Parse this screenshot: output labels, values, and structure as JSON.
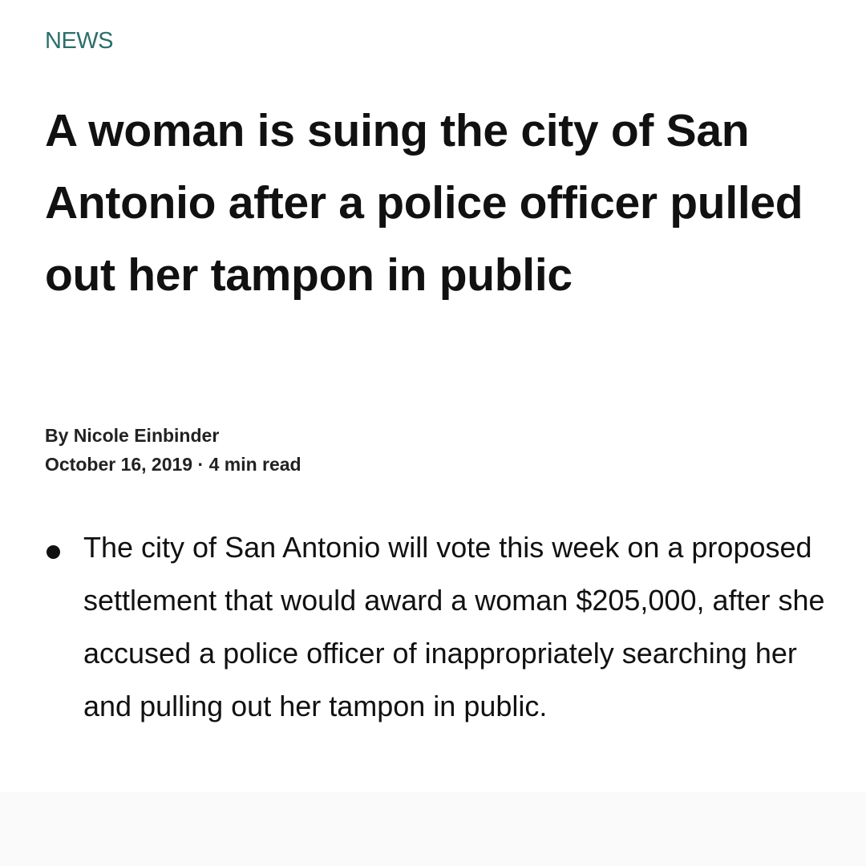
{
  "article": {
    "category": "NEWS",
    "headline": "A woman is suing the city of San Antonio after a police officer pulled out her tampon in public",
    "byline": {
      "prefix": "By ",
      "author": "Nicole Einbinder"
    },
    "date": "October 16, 2019",
    "separator": "·",
    "read_time": "4 min read",
    "bullets": [
      "The city of San Antonio will vote this week on a proposed settlement that would award a woman $205,000, after she accused a police officer of inappropriately searching her and pulling out her tampon in public."
    ]
  },
  "colors": {
    "category": "#2b6f6b",
    "text": "#111111",
    "background": "#ffffff",
    "footer_band": "#fafafa"
  }
}
